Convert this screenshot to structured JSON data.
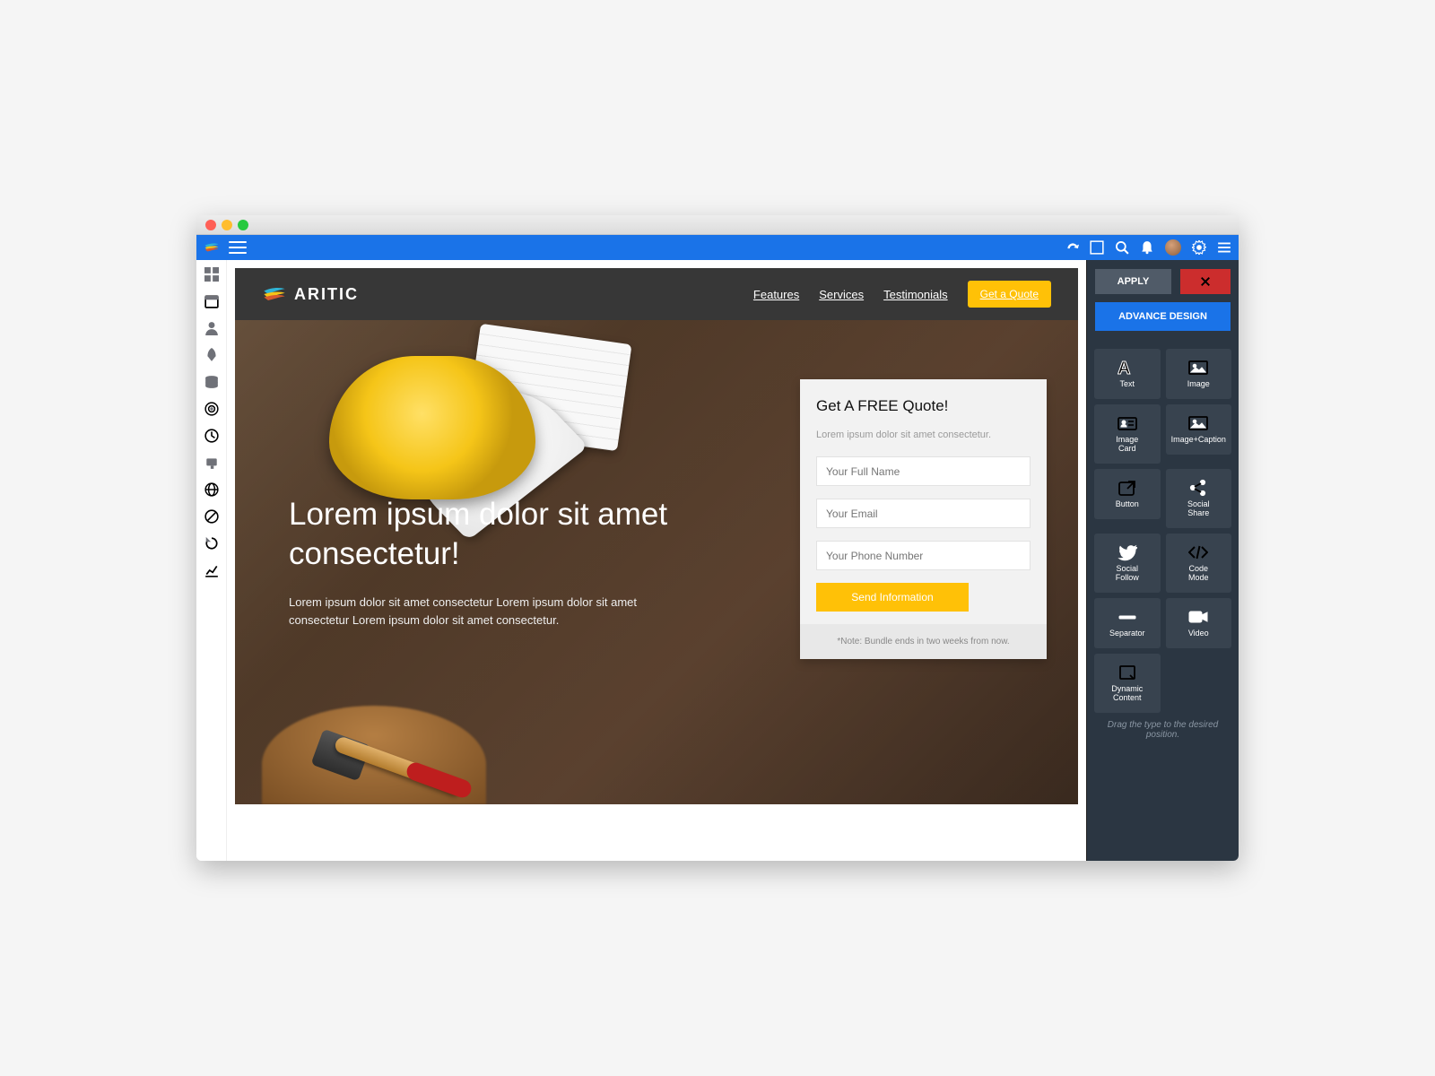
{
  "brand_name": "ARITIC",
  "topbar": {},
  "nav": {
    "items": [
      "Features",
      "Services",
      "Testimonials"
    ],
    "cta": "Get a Quote"
  },
  "hero": {
    "title": "Lorem ipsum dolor sit amet consectetur!",
    "subtitle": "Lorem ipsum dolor sit amet consectetur Lorem ipsum dolor sit amet consectetur Lorem ipsum dolor sit amet consectetur."
  },
  "form": {
    "title": "Get A FREE Quote!",
    "subtitle": "Lorem ipsum dolor sit amet consectetur.",
    "name_placeholder": "Your Full Name",
    "email_placeholder": "Your Email",
    "phone_placeholder": "Your Phone Number",
    "submit": "Send Information",
    "note": "*Note: Bundle ends in two weeks from now."
  },
  "panel": {
    "apply": "APPLY",
    "advance": "ADVANCE DESIGN",
    "hint": "Drag the type to the desired position.",
    "widgets": [
      {
        "label": "Text",
        "icon": "text"
      },
      {
        "label": "Image",
        "icon": "image"
      },
      {
        "label": "Image\nCard",
        "icon": "idcard"
      },
      {
        "label": "Image+Caption",
        "icon": "image"
      },
      {
        "label": "Button",
        "icon": "external"
      },
      {
        "label": "Social\nShare",
        "icon": "share"
      },
      {
        "label": "Social\nFollow",
        "icon": "twitter"
      },
      {
        "label": "Code\nMode",
        "icon": "code"
      },
      {
        "label": "Separator",
        "icon": "sep"
      },
      {
        "label": "Video",
        "icon": "video"
      },
      {
        "label": "Dynamic\nContent",
        "icon": "dynbox"
      }
    ]
  },
  "colors": {
    "primary": "#1a73e8",
    "accent": "#ffc107",
    "danger": "#cc2d2d",
    "panel": "#2b3642"
  }
}
